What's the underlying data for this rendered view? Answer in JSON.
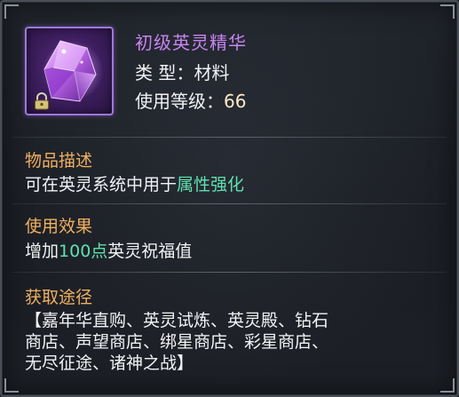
{
  "item": {
    "name": "初级英灵精华",
    "type_label": "类 型：",
    "type_value": "材料",
    "level_label": "使用等级：",
    "level_value": "66",
    "icon": "purple-crystal-icon",
    "locked_icon": "lock-icon"
  },
  "description": {
    "title": "物品描述",
    "text_prefix": "可在英灵系统中用于",
    "text_highlight": "属性强化"
  },
  "effect": {
    "title": "使用效果",
    "text_prefix": "增加",
    "text_highlight": "100点",
    "text_suffix": "英灵祝福值"
  },
  "source": {
    "title": "获取途径",
    "lines": [
      "【嘉年华直购、英灵试炼、英灵殿、钻石",
      "商店、声望商店、绑星商店、彩星商店、",
      "无尽征途、诸神之战】"
    ]
  },
  "colors": {
    "name_purple": "#c785f2",
    "section_orange": "#f0b060",
    "highlight_green": "#5fe0b0"
  }
}
